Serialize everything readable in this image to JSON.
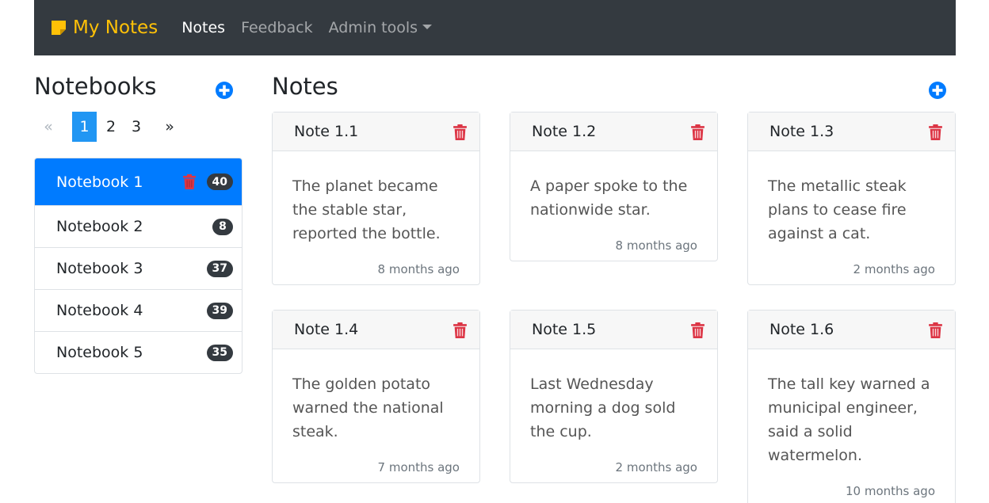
{
  "navbar": {
    "brand": "My Notes",
    "links": [
      "Notes",
      "Feedback",
      "Admin tools"
    ],
    "colors": {
      "background": "#343a40",
      "brand": "#ffc107"
    }
  },
  "notebooks": {
    "heading": "Notebooks",
    "pagination": {
      "prev": "«",
      "pages": [
        "1",
        "2",
        "3"
      ],
      "next": "»",
      "active": "1"
    },
    "items": [
      {
        "label": "Notebook 1",
        "count": "40"
      },
      {
        "label": "Notebook 2",
        "count": "8"
      },
      {
        "label": "Notebook 3",
        "count": "37"
      },
      {
        "label": "Notebook 4",
        "count": "39"
      },
      {
        "label": "Notebook 5",
        "count": "35"
      }
    ]
  },
  "notes": {
    "heading": "Notes",
    "items": [
      {
        "title": "Note 1.1",
        "text": "The planet became the stable star, reported the bottle.",
        "time": "8 months ago"
      },
      {
        "title": "Note 1.2",
        "text": "A paper spoke to the nationwide star.",
        "time": "8 months ago"
      },
      {
        "title": "Note 1.3",
        "text": "The metallic steak plans to cease fire against a cat.",
        "time": "2 months ago"
      },
      {
        "title": "Note 1.4",
        "text": "The golden potato warned the national steak.",
        "time": "7 months ago"
      },
      {
        "title": "Note 1.5",
        "text": "Last Wednesday morning a dog sold the cup.",
        "time": "2 months ago"
      },
      {
        "title": "Note 1.6",
        "text": "The tall key warned a municipal engineer, said a solid watermelon.",
        "time": "10 months ago"
      }
    ]
  },
  "icons": {
    "add": "plus-circle-icon",
    "delete": "trash-icon",
    "brand": "sticky-note-icon"
  },
  "accent_colors": {
    "primary": "#007bff",
    "danger": "#dc3545",
    "pagination_active": "#2196f3"
  }
}
